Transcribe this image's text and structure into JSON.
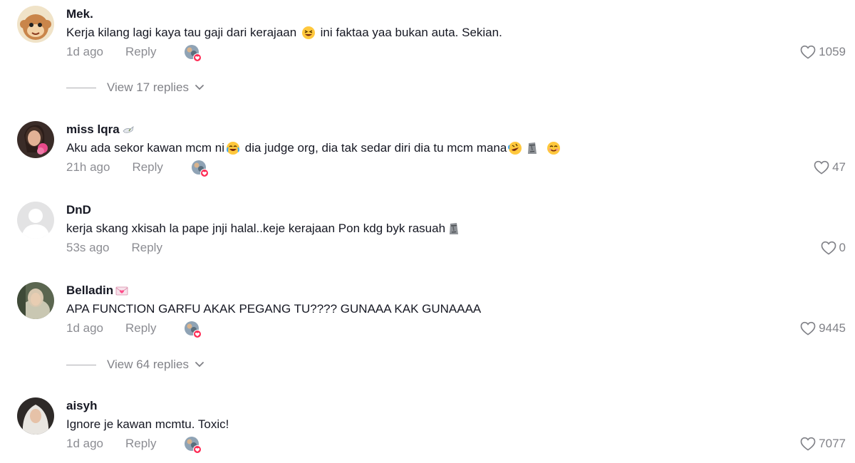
{
  "colors": {
    "text_primary": "#161823",
    "text_secondary": "#8a8b91",
    "like_badge": "#fe2c55"
  },
  "comments": [
    {
      "username": "Mek.",
      "text_parts": [
        "Kerja kilang lagi kaya tau gaji dari kerajaan ",
        " ini faktaa yaa bukan auta. Sekian."
      ],
      "emojis": [
        "grinning-squinting-face"
      ],
      "time": "1d ago",
      "reply_label": "Reply",
      "likes": "1059",
      "view_replies": "View 17 replies"
    },
    {
      "username": "miss lqra",
      "name_emoji": "dove-emoji",
      "text_parts": [
        "Aku ada sekor kawan mcm ni",
        " dia judge org, dia tak sedar diri dia tu mcm mana"
      ],
      "emojis": [
        "face-with-tears-of-joy",
        "rolling-on-floor-laughing",
        "moai",
        "smiling-face"
      ],
      "time": "21h ago",
      "reply_label": "Reply",
      "likes": "47"
    },
    {
      "username": "DnD",
      "text_parts": [
        "kerja skang xkisah la pape jnji halal..keje kerajaan Pon kdg byk rasuah"
      ],
      "emojis": [
        "moai"
      ],
      "time": "53s ago",
      "reply_label": "Reply",
      "likes": "0"
    },
    {
      "username": "Belladin",
      "name_emoji": "love-letter-emoji",
      "text_parts": [
        "APA FUNCTION GARFU AKAK PEGANG TU???? GUNAAA KAK GUNAAAA"
      ],
      "emojis": [],
      "time": "1d ago",
      "reply_label": "Reply",
      "likes": "9445",
      "view_replies": "View 64 replies"
    },
    {
      "username": "aisyh",
      "text_parts": [
        "Ignore je kawan mcmtu. Toxic!"
      ],
      "emojis": [],
      "time": "1d ago",
      "reply_label": "Reply",
      "likes": "7077"
    }
  ]
}
